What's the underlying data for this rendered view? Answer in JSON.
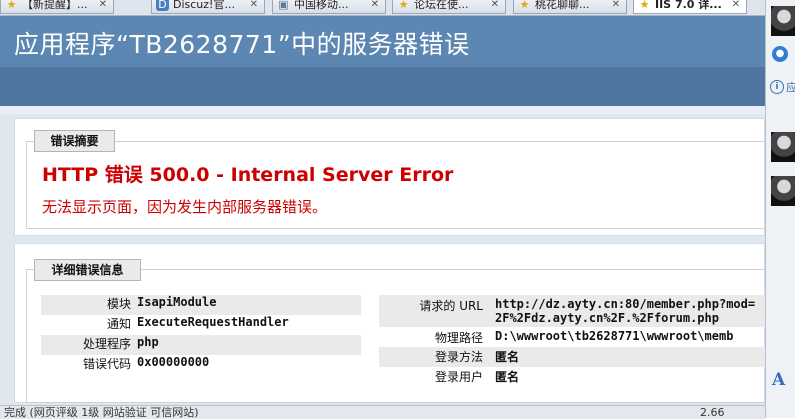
{
  "tabs": [
    {
      "label": "【新提醒】...",
      "icon": "notification-icon",
      "icon_glyph": "★",
      "icon_color": "#e8a317"
    },
    {
      "label": "Discuz!官...",
      "icon": "discuz-icon",
      "icon_glyph": "D",
      "icon_color": "#4a7cc0"
    },
    {
      "label": "中国移动...",
      "icon": "page-icon",
      "icon_glyph": "▣",
      "icon_color": "#5c7a99"
    },
    {
      "label": "论坛在使...",
      "icon": "forum-icon",
      "icon_glyph": "★",
      "icon_color": "#e8a317"
    },
    {
      "label": "桃花聊聊...",
      "icon": "forum-icon",
      "icon_glyph": "★",
      "icon_color": "#e8a317"
    },
    {
      "label": "IIS 7.0 详...",
      "icon": "forum-icon",
      "icon_glyph": "★",
      "icon_color": "#e8a317"
    }
  ],
  "page": {
    "title": "应用程序“TB2628771”中的服务器错误"
  },
  "summary": {
    "legend": "错误摘要",
    "error_code": "HTTP 错误  500.0 - Internal Server Error",
    "error_desc": "无法显示页面，因为发生内部服务器错误。"
  },
  "details": {
    "legend": "详细错误信息",
    "left": [
      {
        "label": "模块",
        "value": "IsapiModule"
      },
      {
        "label": "通知",
        "value": "ExecuteRequestHandler"
      },
      {
        "label": "处理程序",
        "value": "php"
      },
      {
        "label": "错误代码",
        "value": "0x00000000"
      }
    ],
    "right": [
      {
        "label": "请求的 URL",
        "value": "http://dz.ayty.cn:80/member.php?mod=",
        "value2": "2F%2Fdz.ayty.cn%2F.%2Fforum.php"
      },
      {
        "label": "物理路径",
        "value": "D:\\wwwroot\\tb2628771\\wwwroot\\memb"
      },
      {
        "label": "登录方法",
        "value": "匿名"
      },
      {
        "label": "登录用户",
        "value": "匿名"
      }
    ]
  },
  "statusbar": {
    "text": "完成 (网页评级 1级 网站验证 可信网站)",
    "zoom": "2.66"
  },
  "sidebar": {
    "text": "应",
    "font_glyph": "A"
  },
  "colors": {
    "header_bg": "#5c87b2",
    "error_red": "#cc0000"
  }
}
